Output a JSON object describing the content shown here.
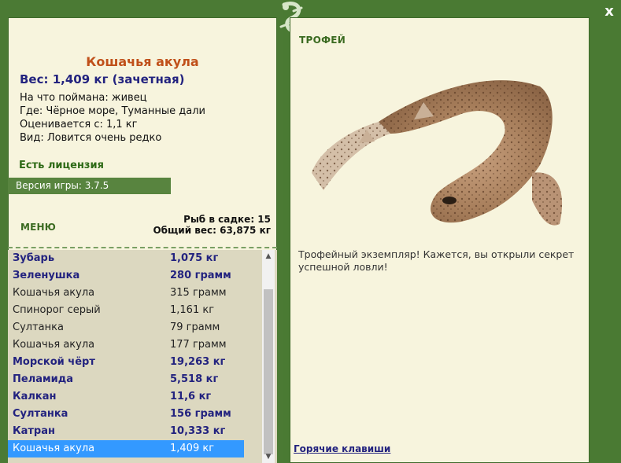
{
  "window": {
    "close_label": "x"
  },
  "left": {
    "fish_title": "Кошачья акула",
    "weight_line": "Вес: 1,409 кг (зачетная)",
    "info": [
      "На что поймана: живец",
      "Где: Чёрное море, Туманные дали",
      "Оценивается с: 1,1 кг",
      "Вид: Ловится очень редко"
    ],
    "license": "Есть лицензия",
    "version": "Версия игры: 3.7.5",
    "menu_label": "МЕНЮ",
    "stats": {
      "fish_count": "Рыб в садке: 15",
      "total_weight": "Общий вес: 63,875 кг"
    },
    "catch_list": [
      {
        "name": "Зубарь",
        "weight": "1,075 кг",
        "style": "bold"
      },
      {
        "name": "Зеленушка",
        "weight": "280 грамм",
        "style": "bold"
      },
      {
        "name": "Кошачья акула",
        "weight": "315 грамм",
        "style": "normal"
      },
      {
        "name": "Спинорог серый",
        "weight": "1,161 кг",
        "style": "normal"
      },
      {
        "name": "Султанка",
        "weight": "79 грамм",
        "style": "normal"
      },
      {
        "name": "Кошачья акула",
        "weight": "177 грамм",
        "style": "normal"
      },
      {
        "name": "Морской чёрт",
        "weight": "19,263 кг",
        "style": "bold"
      },
      {
        "name": "Пеламида",
        "weight": "5,518 кг",
        "style": "bold"
      },
      {
        "name": "Калкан",
        "weight": "11,6 кг",
        "style": "bold"
      },
      {
        "name": "Султанка",
        "weight": "156 грамм",
        "style": "bold"
      },
      {
        "name": "Катран",
        "weight": "10,333 кг",
        "style": "bold"
      },
      {
        "name": "Кошачья акула",
        "weight": "1,409 кг",
        "style": "sel"
      }
    ]
  },
  "right": {
    "trophy_title": "ТРОФЕЙ",
    "trophy_text": "Трофейный экземпляр! Кажется, вы открыли секрет успешной ловли!",
    "hotkeys_label": "Горячие клавиши"
  },
  "colors": {
    "frame": "#4b7a34",
    "panel": "#f7f4dd",
    "list_bg": "#dcd8c0",
    "accent_orange": "#c0501a",
    "accent_navy": "#23237f",
    "accent_green": "#2e6a16",
    "selection": "#3399ff"
  },
  "icons": [
    "lizard-logo-icon",
    "close-icon",
    "scroll-up-icon",
    "scroll-down-icon",
    "shark-image"
  ]
}
